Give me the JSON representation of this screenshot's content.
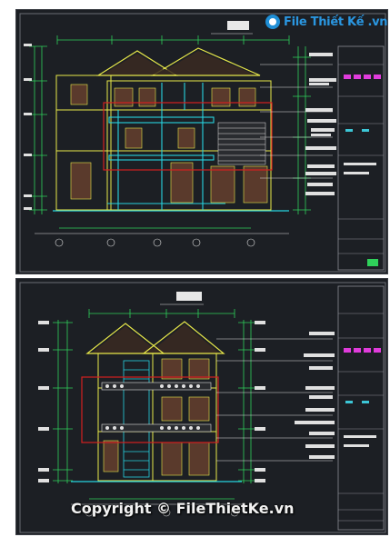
{
  "header": {
    "logo_text": "File Thiết Kế .vn"
  },
  "footer": {
    "watermark": "Copyright © FileThietKe.vn"
  },
  "icons": {
    "logo": "filethietke-logo-icon"
  },
  "colors": {
    "sheet_background": "#1c1f24",
    "drawing_yellow": "#e8e84a",
    "drawing_cyan": "#27d3e0",
    "drawing_green": "#2fd05a",
    "highlight_red": "#d42020",
    "title_block_magenta": "#e03cdc",
    "brand_blue": "#2a96e0"
  }
}
